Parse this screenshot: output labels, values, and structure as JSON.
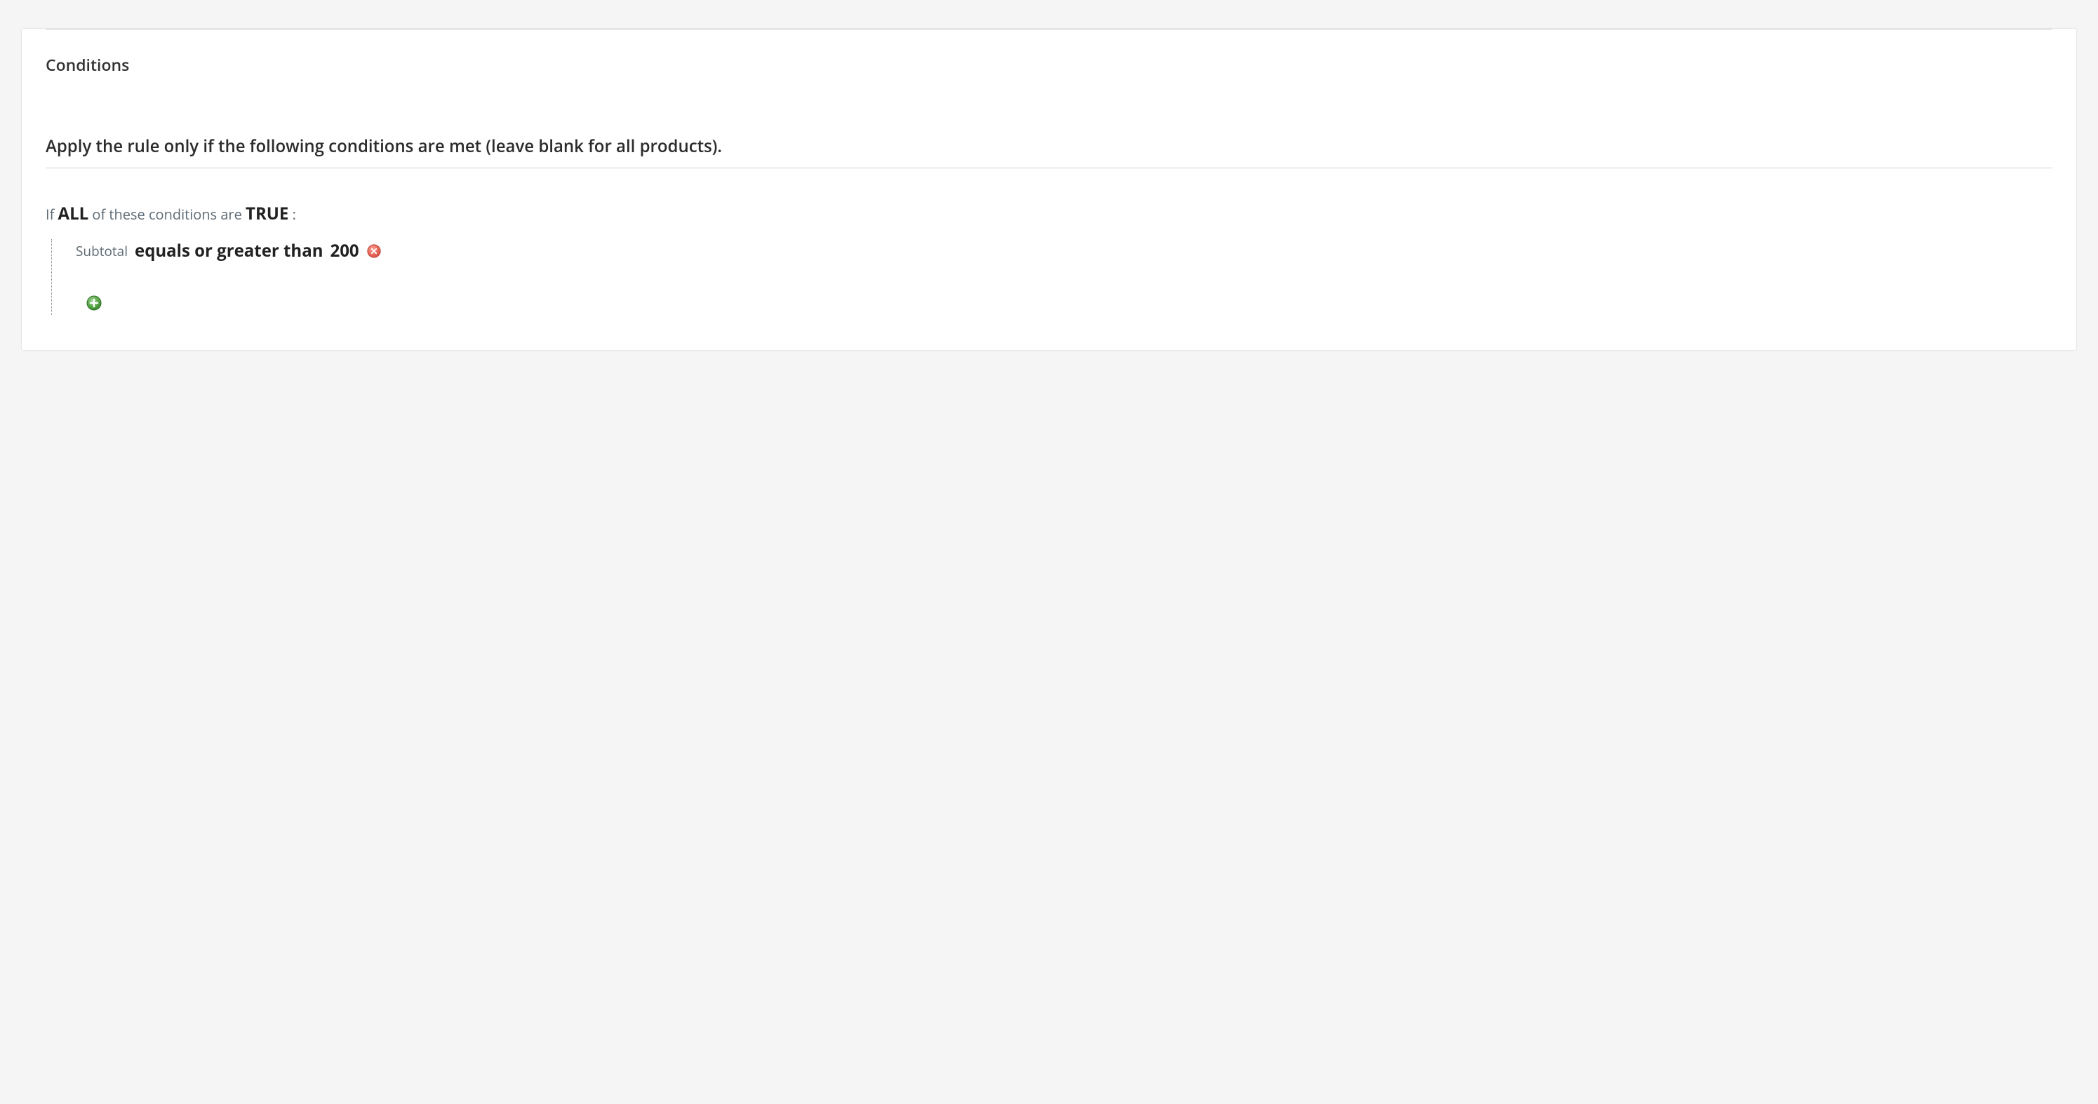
{
  "section": {
    "title": "Conditions",
    "description": "Apply the rule only if the following conditions are met (leave blank for all products)."
  },
  "rule_root": {
    "prefix": "If",
    "aggregator": "ALL",
    "middle": "of these conditions are",
    "value": "TRUE",
    "colon": ":"
  },
  "conditions": [
    {
      "attribute": "Subtotal",
      "operator": "equals or greater than",
      "value": "200"
    }
  ]
}
